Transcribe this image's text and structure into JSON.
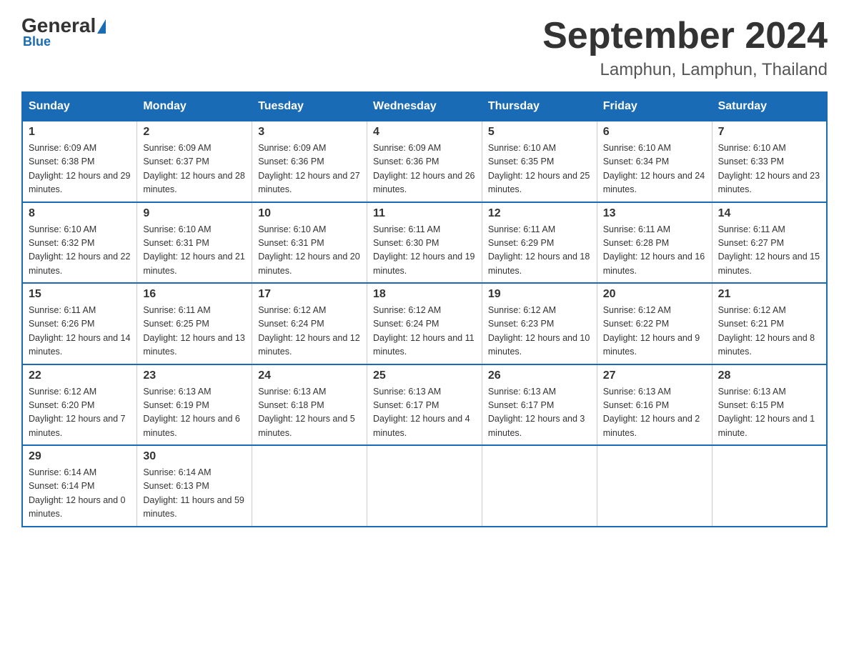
{
  "header": {
    "logo_general": "General",
    "logo_blue": "Blue",
    "title": "September 2024",
    "subtitle": "Lamphun, Lamphun, Thailand"
  },
  "days_of_week": [
    "Sunday",
    "Monday",
    "Tuesday",
    "Wednesday",
    "Thursday",
    "Friday",
    "Saturday"
  ],
  "weeks": [
    [
      {
        "day": "1",
        "sunrise": "6:09 AM",
        "sunset": "6:38 PM",
        "daylight": "12 hours and 29 minutes."
      },
      {
        "day": "2",
        "sunrise": "6:09 AM",
        "sunset": "6:37 PM",
        "daylight": "12 hours and 28 minutes."
      },
      {
        "day": "3",
        "sunrise": "6:09 AM",
        "sunset": "6:36 PM",
        "daylight": "12 hours and 27 minutes."
      },
      {
        "day": "4",
        "sunrise": "6:09 AM",
        "sunset": "6:36 PM",
        "daylight": "12 hours and 26 minutes."
      },
      {
        "day": "5",
        "sunrise": "6:10 AM",
        "sunset": "6:35 PM",
        "daylight": "12 hours and 25 minutes."
      },
      {
        "day": "6",
        "sunrise": "6:10 AM",
        "sunset": "6:34 PM",
        "daylight": "12 hours and 24 minutes."
      },
      {
        "day": "7",
        "sunrise": "6:10 AM",
        "sunset": "6:33 PM",
        "daylight": "12 hours and 23 minutes."
      }
    ],
    [
      {
        "day": "8",
        "sunrise": "6:10 AM",
        "sunset": "6:32 PM",
        "daylight": "12 hours and 22 minutes."
      },
      {
        "day": "9",
        "sunrise": "6:10 AM",
        "sunset": "6:31 PM",
        "daylight": "12 hours and 21 minutes."
      },
      {
        "day": "10",
        "sunrise": "6:10 AM",
        "sunset": "6:31 PM",
        "daylight": "12 hours and 20 minutes."
      },
      {
        "day": "11",
        "sunrise": "6:11 AM",
        "sunset": "6:30 PM",
        "daylight": "12 hours and 19 minutes."
      },
      {
        "day": "12",
        "sunrise": "6:11 AM",
        "sunset": "6:29 PM",
        "daylight": "12 hours and 18 minutes."
      },
      {
        "day": "13",
        "sunrise": "6:11 AM",
        "sunset": "6:28 PM",
        "daylight": "12 hours and 16 minutes."
      },
      {
        "day": "14",
        "sunrise": "6:11 AM",
        "sunset": "6:27 PM",
        "daylight": "12 hours and 15 minutes."
      }
    ],
    [
      {
        "day": "15",
        "sunrise": "6:11 AM",
        "sunset": "6:26 PM",
        "daylight": "12 hours and 14 minutes."
      },
      {
        "day": "16",
        "sunrise": "6:11 AM",
        "sunset": "6:25 PM",
        "daylight": "12 hours and 13 minutes."
      },
      {
        "day": "17",
        "sunrise": "6:12 AM",
        "sunset": "6:24 PM",
        "daylight": "12 hours and 12 minutes."
      },
      {
        "day": "18",
        "sunrise": "6:12 AM",
        "sunset": "6:24 PM",
        "daylight": "12 hours and 11 minutes."
      },
      {
        "day": "19",
        "sunrise": "6:12 AM",
        "sunset": "6:23 PM",
        "daylight": "12 hours and 10 minutes."
      },
      {
        "day": "20",
        "sunrise": "6:12 AM",
        "sunset": "6:22 PM",
        "daylight": "12 hours and 9 minutes."
      },
      {
        "day": "21",
        "sunrise": "6:12 AM",
        "sunset": "6:21 PM",
        "daylight": "12 hours and 8 minutes."
      }
    ],
    [
      {
        "day": "22",
        "sunrise": "6:12 AM",
        "sunset": "6:20 PM",
        "daylight": "12 hours and 7 minutes."
      },
      {
        "day": "23",
        "sunrise": "6:13 AM",
        "sunset": "6:19 PM",
        "daylight": "12 hours and 6 minutes."
      },
      {
        "day": "24",
        "sunrise": "6:13 AM",
        "sunset": "6:18 PM",
        "daylight": "12 hours and 5 minutes."
      },
      {
        "day": "25",
        "sunrise": "6:13 AM",
        "sunset": "6:17 PM",
        "daylight": "12 hours and 4 minutes."
      },
      {
        "day": "26",
        "sunrise": "6:13 AM",
        "sunset": "6:17 PM",
        "daylight": "12 hours and 3 minutes."
      },
      {
        "day": "27",
        "sunrise": "6:13 AM",
        "sunset": "6:16 PM",
        "daylight": "12 hours and 2 minutes."
      },
      {
        "day": "28",
        "sunrise": "6:13 AM",
        "sunset": "6:15 PM",
        "daylight": "12 hours and 1 minute."
      }
    ],
    [
      {
        "day": "29",
        "sunrise": "6:14 AM",
        "sunset": "6:14 PM",
        "daylight": "12 hours and 0 minutes."
      },
      {
        "day": "30",
        "sunrise": "6:14 AM",
        "sunset": "6:13 PM",
        "daylight": "11 hours and 59 minutes."
      },
      null,
      null,
      null,
      null,
      null
    ]
  ],
  "labels": {
    "sunrise_prefix": "Sunrise: ",
    "sunset_prefix": "Sunset: ",
    "daylight_prefix": "Daylight: "
  }
}
